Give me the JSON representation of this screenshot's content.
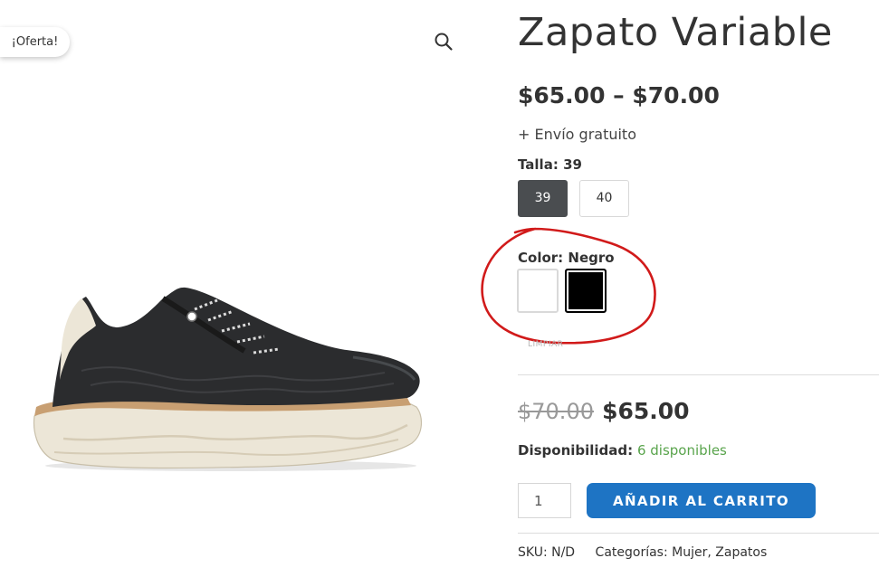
{
  "gallery": {
    "sale_badge": "¡Oferta!",
    "zoom_icon": "search-icon"
  },
  "product": {
    "title": "Zapato Variable",
    "price_range": "$65.00 – $70.00",
    "shipping": "+ Envío gratuito"
  },
  "attributes": {
    "size": {
      "label": "Talla:",
      "selected": "39",
      "options": [
        "39",
        "40"
      ]
    },
    "color": {
      "label": "Color:",
      "selected": "Negro",
      "options": [
        {
          "name": "Blanco",
          "hex": "#ffffff"
        },
        {
          "name": "Negro",
          "hex": "#000000"
        }
      ]
    },
    "clear_label": "LIMPIAR"
  },
  "variation": {
    "old_price": "$70.00",
    "new_price": "$65.00",
    "availability_label": "Disponibilidad:",
    "availability_value": "6 disponibles"
  },
  "cart": {
    "quantity": "1",
    "add_button": "AÑADIR AL CARRITO"
  },
  "meta": {
    "sku_label": "SKU:",
    "sku_value": "N/D",
    "categories_label": "Categorías:",
    "categories": [
      "Mujer",
      "Zapatos"
    ]
  },
  "colors": {
    "accent": "#1e74c4",
    "in_stock": "#59a44c",
    "selected_swatch": "#4a4d50",
    "annotation": "#d11a1a"
  }
}
